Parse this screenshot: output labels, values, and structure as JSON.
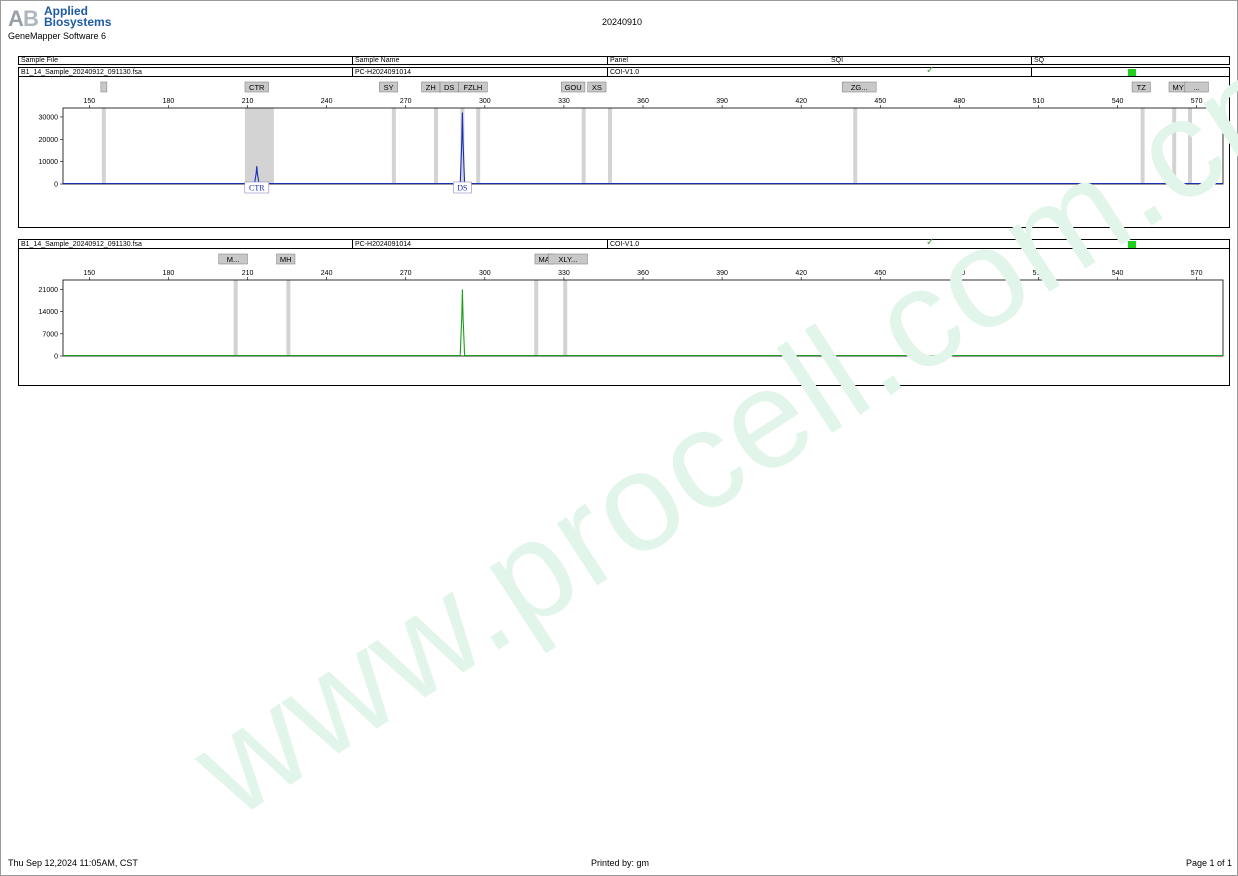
{
  "header": {
    "logo_line1": "Applied",
    "logo_line2": "Biosystems",
    "software": "GeneMapper Software 6",
    "report_title": "20240910"
  },
  "columns": {
    "sample_file": "Sample File",
    "sample_name": "Sample Name",
    "panel": "Panel",
    "sqi": "SQI",
    "sq": "SQ"
  },
  "footer": {
    "date": "Thu Sep 12,2024 11:05AM, CST",
    "printed_by": "Printed by: gm",
    "page": "Page 1 of 1"
  },
  "watermark": "www.procell.com.cn",
  "colors": {
    "trace_blue": "#1a2fb8",
    "trace_green": "#1a9e1a",
    "bin_grey": "#d3d3d3",
    "marker_fill": "#c8c8c8",
    "sq_green": "#1ecf1e"
  },
  "chart_data": [
    {
      "type": "line",
      "sample_file": "B1_14_Sample_20240912_091130.fsa",
      "sample_name": "PC-H2024091014",
      "panel": "COI-V1.0",
      "sqi": "✓",
      "xlim": [
        140,
        580
      ],
      "ylim": [
        0,
        34000
      ],
      "xticks": [
        150,
        180,
        210,
        240,
        270,
        300,
        330,
        360,
        390,
        420,
        450,
        480,
        510,
        540,
        570
      ],
      "yticks": [
        0,
        10000,
        20000,
        30000
      ],
      "series": [
        {
          "color": "#1a2fb8",
          "peaks": [
            {
              "x": 213.5,
              "y": 8000
            },
            {
              "x": 291.5,
              "y": 32000
            }
          ]
        }
      ],
      "bins": [
        155.5,
        214.5,
        265.5,
        281.5,
        291.5,
        297.5,
        337.5,
        347.5,
        440.5,
        549.5,
        561.5,
        567.5
      ],
      "wide_bins": [
        {
          "from": 209,
          "to": 220
        }
      ],
      "markers": [
        {
          "label": "",
          "x": 155.5
        },
        {
          "label": "CTR",
          "x": 213.5
        },
        {
          "label": "SY",
          "x": 263.5
        },
        {
          "label": "ZH",
          "x": 279.5
        },
        {
          "label": "DS",
          "x": 286.5
        },
        {
          "label": "FZLH",
          "x": 295.5
        },
        {
          "label": "GOU",
          "x": 333.5
        },
        {
          "label": "XS",
          "x": 342.5
        },
        {
          "label": "ZG...",
          "x": 442
        },
        {
          "label": "TZ",
          "x": 549
        },
        {
          "label": "MY",
          "x": 563
        },
        {
          "label": "...",
          "x": 570
        }
      ],
      "peak_labels": [
        {
          "label": "CTR",
          "x": 213.5
        },
        {
          "label": "DS",
          "x": 291.5
        }
      ]
    },
    {
      "type": "line",
      "sample_file": "B1_14_Sample_20240912_091130.fsa",
      "sample_name": "PC-H2024091014",
      "panel": "COI-V1.0",
      "sqi": "✓",
      "xlim": [
        140,
        580
      ],
      "ylim": [
        0,
        24000
      ],
      "xticks": [
        150,
        180,
        210,
        240,
        270,
        300,
        330,
        360,
        390,
        420,
        450,
        480,
        510,
        540,
        570
      ],
      "yticks": [
        0,
        7000,
        14000,
        21000
      ],
      "series": [
        {
          "color": "#1a9e1a",
          "peaks": [
            {
              "x": 291.5,
              "y": 21000
            }
          ]
        }
      ],
      "bins": [
        205.5,
        225.5,
        319.5,
        330.5
      ],
      "wide_bins": [],
      "markers": [
        {
          "label": "M...",
          "x": 204.5
        },
        {
          "label": "MH",
          "x": 224.5
        },
        {
          "label": "MA",
          "x": 322.5
        },
        {
          "label": "XLY...",
          "x": 331.5
        }
      ],
      "peak_labels": []
    }
  ]
}
